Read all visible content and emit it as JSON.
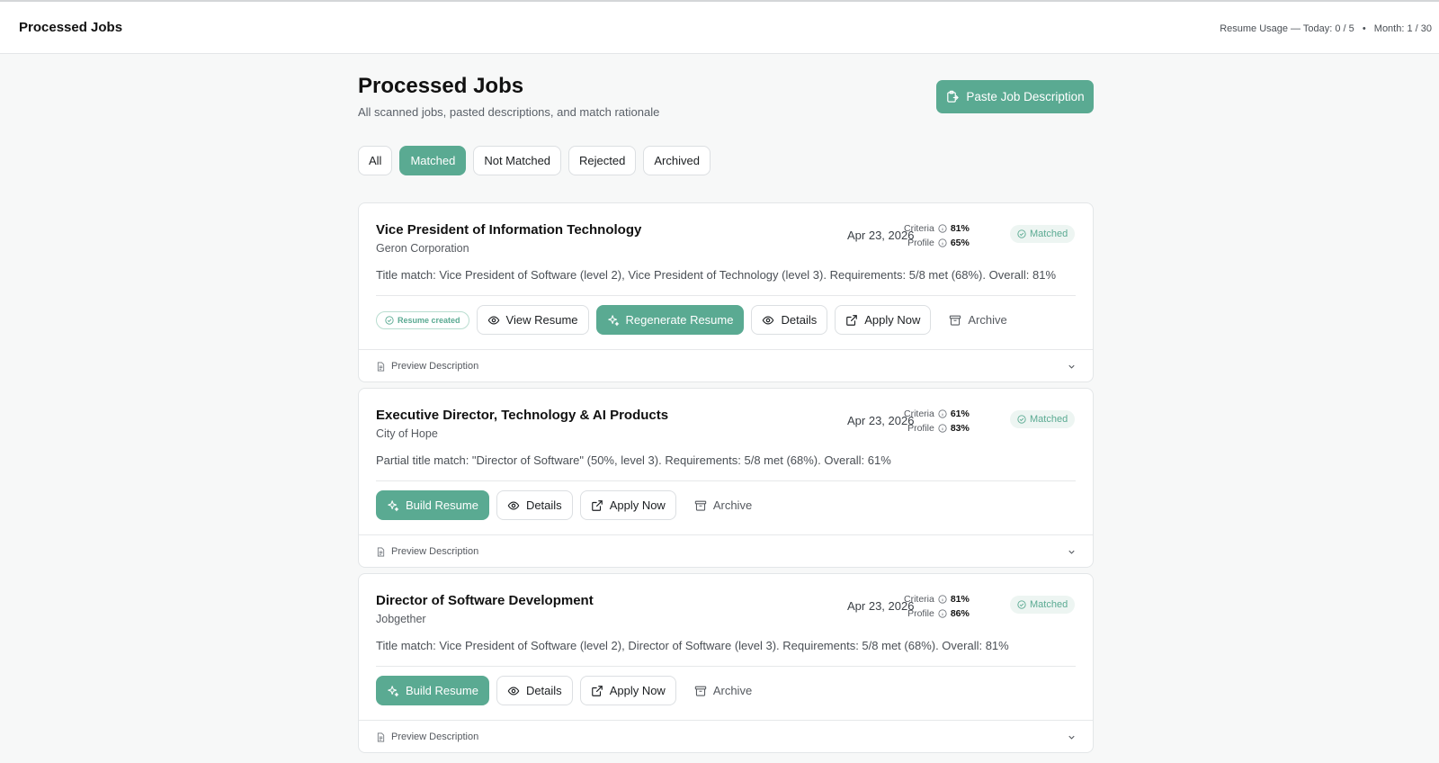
{
  "header": {
    "app_title": "Processed Jobs",
    "usage_label": "Resume Usage —",
    "usage_today": "Today: 0 / 5",
    "usage_sep": "•",
    "usage_month": "Month: 1 / 30"
  },
  "page": {
    "title": "Processed Jobs",
    "subtitle": "All scanned jobs, pasted descriptions, and match rationale",
    "paste_button": "Paste Job Description"
  },
  "filters": [
    {
      "label": "All",
      "active": false
    },
    {
      "label": "Matched",
      "active": true
    },
    {
      "label": "Not Matched",
      "active": false
    },
    {
      "label": "Rejected",
      "active": false
    },
    {
      "label": "Archived",
      "active": false
    }
  ],
  "labels": {
    "criteria": "Criteria",
    "profile": "Profile",
    "resume_created": "Resume created",
    "view_resume": "View Resume",
    "regenerate_resume": "Regenerate Resume",
    "build_resume": "Build Resume",
    "details": "Details",
    "apply_now": "Apply Now",
    "archive": "Archive",
    "preview_description": "Preview Description"
  },
  "jobs": [
    {
      "title": "Vice President of Information Technology",
      "company": "Geron Corporation",
      "date": "Apr 23, 2026",
      "criteria": "81%",
      "profile": "65%",
      "status": "Matched",
      "rationale": "Title match: Vice President of Software (level 2), Vice President of Technology (level 3). Requirements: 5/8 met (68%). Overall: 81%",
      "resume_created": true
    },
    {
      "title": "Executive Director, Technology & AI Products",
      "company": "City of Hope",
      "date": "Apr 23, 2026",
      "criteria": "61%",
      "profile": "83%",
      "status": "Matched",
      "rationale": "Partial title match: \"Director of Software\" (50%, level 3). Requirements: 5/8 met (68%). Overall: 61%",
      "resume_created": false
    },
    {
      "title": "Director of Software Development",
      "company": "Jobgether",
      "date": "Apr 23, 2026",
      "criteria": "81%",
      "profile": "86%",
      "status": "Matched",
      "rationale": "Title match: Vice President of Software (level 2), Director of Software (level 3). Requirements: 5/8 met (68%). Overall: 81%",
      "resume_created": false
    }
  ],
  "colors": {
    "accent": "#5aaa92",
    "badge_bg": "#edf5f2"
  }
}
